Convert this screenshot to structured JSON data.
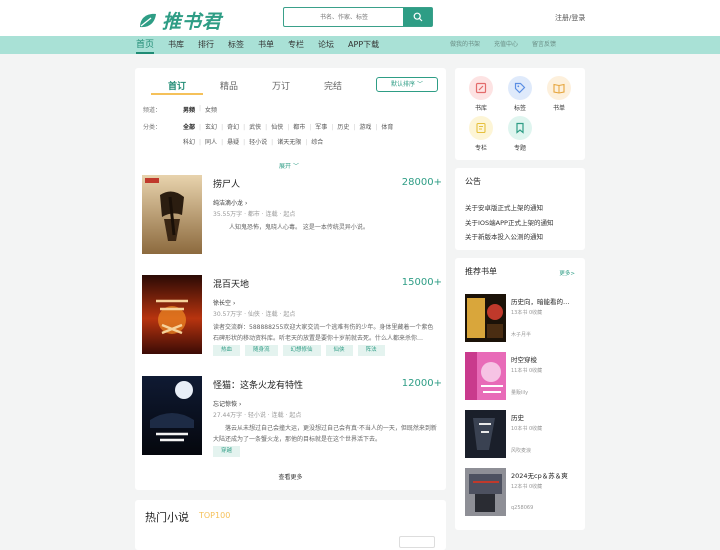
{
  "header": {
    "logo_text": "推书君",
    "search_placeholder": "书名、作家、标签",
    "login_text": "注册/登录"
  },
  "nav": {
    "items": [
      "首页",
      "书库",
      "排行",
      "标签",
      "书单",
      "专栏",
      "论坛",
      "APP下载"
    ],
    "right_items": [
      "做我的书架",
      "充值中心",
      "留言反馈"
    ]
  },
  "main": {
    "tabs": [
      "首订",
      "精品",
      "万订",
      "完结"
    ],
    "sort_label": "默认排序",
    "channel_label": "频道：",
    "channels": [
      "男频",
      "女频"
    ],
    "category_label": "分类：",
    "categories": [
      "全部",
      "玄幻",
      "奇幻",
      "武侠",
      "仙侠",
      "都市",
      "军事",
      "历史",
      "游戏",
      "体育",
      "科幻",
      "同人",
      "悬疑",
      "轻小说",
      "诸天无限",
      "综合"
    ],
    "expand_label": "展开",
    "more_label": "查看更多",
    "books": [
      {
        "title": "捞尸人",
        "count": "28000+",
        "author": "纯洁滴小龙",
        "meta": "35.55万字 · 都市 · 连载 · 起点",
        "desc": "人知鬼恐怖，鬼晓人心毒。 这是一本传统灵异小说。",
        "tags": []
      },
      {
        "title": "混百天地",
        "count": "15000+",
        "author": "徐长空",
        "meta": "30.57万字 · 仙侠 · 连载 · 起点",
        "desc": "读者交流群：588888255欢迎大家交流一个逃难有伤的少年。身体里藏着一个紫色石碑形状的移动资料库。听老天的放置是要你十岁前就去死。什么人都来杀你…",
        "tags": [
          "热血",
          "随身流",
          "幻想修仙",
          "仙侠",
          "阵法"
        ]
      },
      {
        "title": "怪猫：这条火龙有特性",
        "count": "12000+",
        "author": "忘记惊恢",
        "meta": "27.44万字 · 轻小说 · 连载 · 起点",
        "desc": "落云从未想过自己会撞大运，更没想过自己会有真·不当人的一天，但既然来到新大陆还成为了一条蟹火龙，那他的目标就是在这个世界活下去。",
        "tags": [
          "穿越"
        ]
      }
    ]
  },
  "hot": {
    "title": "热门小说",
    "subtitle": "TOP100"
  },
  "side_categories": [
    {
      "label": "书库",
      "icon": "book-library-icon",
      "color": "#fde3e3",
      "fg": "#e36a6a"
    },
    {
      "label": "标签",
      "icon": "tag-icon",
      "color": "#dfeafb",
      "fg": "#5b8ee3"
    },
    {
      "label": "书单",
      "icon": "booklist-icon",
      "color": "#fdf0dc",
      "fg": "#e6a53c"
    },
    {
      "label": "专栏",
      "icon": "column-icon",
      "color": "#fdf5d6",
      "fg": "#e6c03c"
    },
    {
      "label": "专题",
      "icon": "bookmark-icon",
      "color": "#dff5ef",
      "fg": "#2e9d85"
    }
  ],
  "notice": {
    "title": "公告",
    "items": [
      "关于安卓版正式上架的通知",
      "关于IOS端APP正式上架的通知",
      "关于新版本投入公测的通知"
    ]
  },
  "recommend": {
    "title": "推荐书单",
    "more_label": "更多>",
    "items": [
      {
        "title": "历史向，暗能看的…",
        "meta": "13本书 0收藏",
        "author": "木子月半"
      },
      {
        "title": "时空穿梭",
        "meta": "11本书 0收藏",
        "author": "量贩lily"
      },
      {
        "title": "历史",
        "meta": "10本书 0收藏",
        "author": "风吹麦浪"
      },
      {
        "title": "2024无cp＆苏＆爽",
        "meta": "12本书 0收藏",
        "author": "q258069"
      }
    ]
  },
  "colors": {
    "accent": "#2e9d85",
    "nav_bg": "#a9e1d6",
    "tab_underline": "#f5c15a"
  }
}
